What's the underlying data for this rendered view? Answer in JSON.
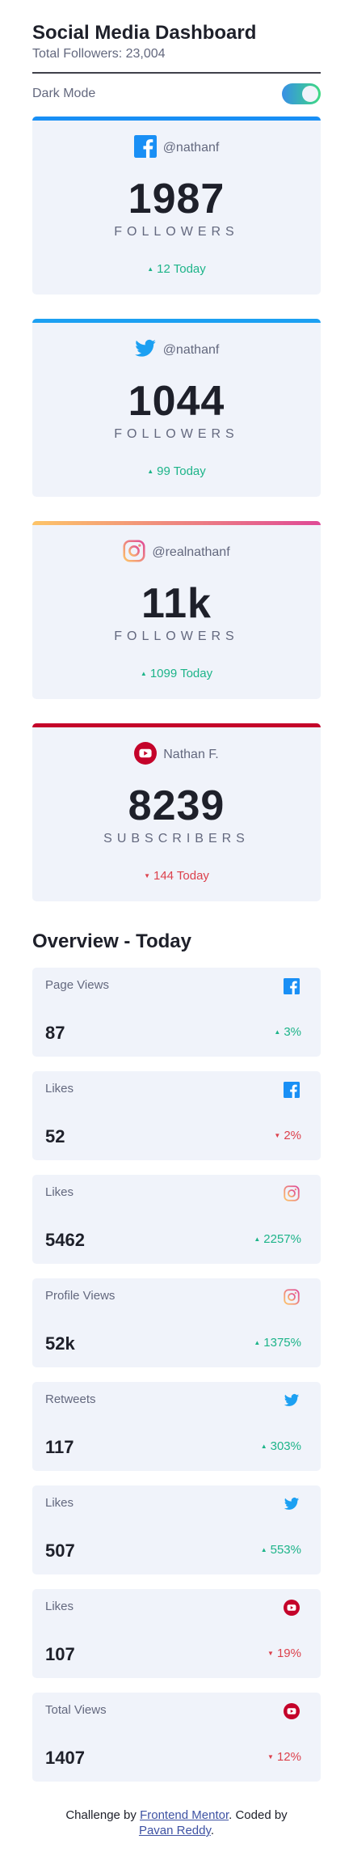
{
  "header": {
    "title": "Social Media Dashboard",
    "subtitle": "Total Followers: 23,004"
  },
  "mode": {
    "label": "Dark Mode",
    "enabled": true
  },
  "colors": {
    "facebook": "#198ff5",
    "twitter": "#1ca0f2",
    "instagram_start": "#fdc468",
    "instagram_end": "#df4996",
    "youtube": "#c4032a",
    "up": "#1db489",
    "down": "#dc414c"
  },
  "cards": [
    {
      "platform": "facebook",
      "icon": "facebook-icon",
      "handle": "@nathanf",
      "count": "1987",
      "unit": "FOLLOWERS",
      "today": "12 Today",
      "trend": "up"
    },
    {
      "platform": "twitter",
      "icon": "twitter-icon",
      "handle": "@nathanf",
      "count": "1044",
      "unit": "FOLLOWERS",
      "today": "99 Today",
      "trend": "up"
    },
    {
      "platform": "instagram",
      "icon": "instagram-icon",
      "handle": "@realnathanf",
      "count": "11k",
      "unit": "FOLLOWERS",
      "today": "1099 Today",
      "trend": "up"
    },
    {
      "platform": "youtube",
      "icon": "youtube-icon",
      "handle": "Nathan F.",
      "count": "8239",
      "unit": "SUBSCRIBERS",
      "today": "144 Today",
      "trend": "down"
    }
  ],
  "overview": {
    "title": "Overview - Today",
    "items": [
      {
        "label": "Page Views",
        "icon": "facebook-icon",
        "value": "87",
        "delta": "3%",
        "trend": "up"
      },
      {
        "label": "Likes",
        "icon": "facebook-icon",
        "value": "52",
        "delta": "2%",
        "trend": "down"
      },
      {
        "label": "Likes",
        "icon": "instagram-icon",
        "value": "5462",
        "delta": "2257%",
        "trend": "up"
      },
      {
        "label": "Profile Views",
        "icon": "instagram-icon",
        "value": "52k",
        "delta": "1375%",
        "trend": "up"
      },
      {
        "label": "Retweets",
        "icon": "twitter-icon",
        "value": "117",
        "delta": "303%",
        "trend": "up"
      },
      {
        "label": "Likes",
        "icon": "twitter-icon",
        "value": "507",
        "delta": "553%",
        "trend": "up"
      },
      {
        "label": "Likes",
        "icon": "youtube-icon",
        "value": "107",
        "delta": "19%",
        "trend": "down"
      },
      {
        "label": "Total Views",
        "icon": "youtube-icon",
        "value": "1407",
        "delta": "12%",
        "trend": "down"
      }
    ]
  },
  "footer": {
    "prefix": "Challenge by ",
    "link1": "Frontend Mentor",
    "middle": ". Coded by ",
    "link2": "Pavan Reddy",
    "suffix": "."
  }
}
